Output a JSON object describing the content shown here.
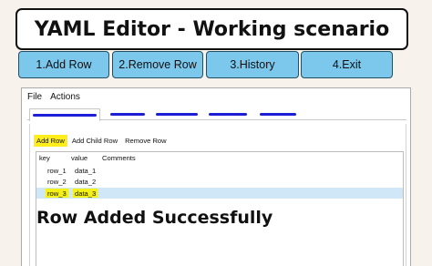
{
  "title": "YAML Editor - Working scenario",
  "nav": {
    "items": [
      {
        "label": "1.Add Row"
      },
      {
        "label": "2.Remove Row"
      },
      {
        "label": "3.History"
      },
      {
        "label": "4.Exit"
      }
    ],
    "color": "#7cc7ec"
  },
  "window": {
    "menu": [
      "File",
      "Actions"
    ],
    "toolbar": {
      "add_row": "Add Row",
      "add_child_row": "Add Child Row",
      "remove_row": "Remove Row"
    },
    "table": {
      "headers": {
        "key": "key",
        "value": "value",
        "comments": "Comments"
      },
      "rows": [
        {
          "key": "row_1",
          "value": "data_1",
          "comments": ""
        },
        {
          "key": "row_2",
          "value": "data_2",
          "comments": ""
        },
        {
          "key": "row_3",
          "value": "data_3",
          "comments": ""
        }
      ],
      "selected_row": 3
    }
  },
  "status_message": "Row Added Successfully",
  "highlight_color": "#ffee1a",
  "redaction_color": "#1d1fd6"
}
